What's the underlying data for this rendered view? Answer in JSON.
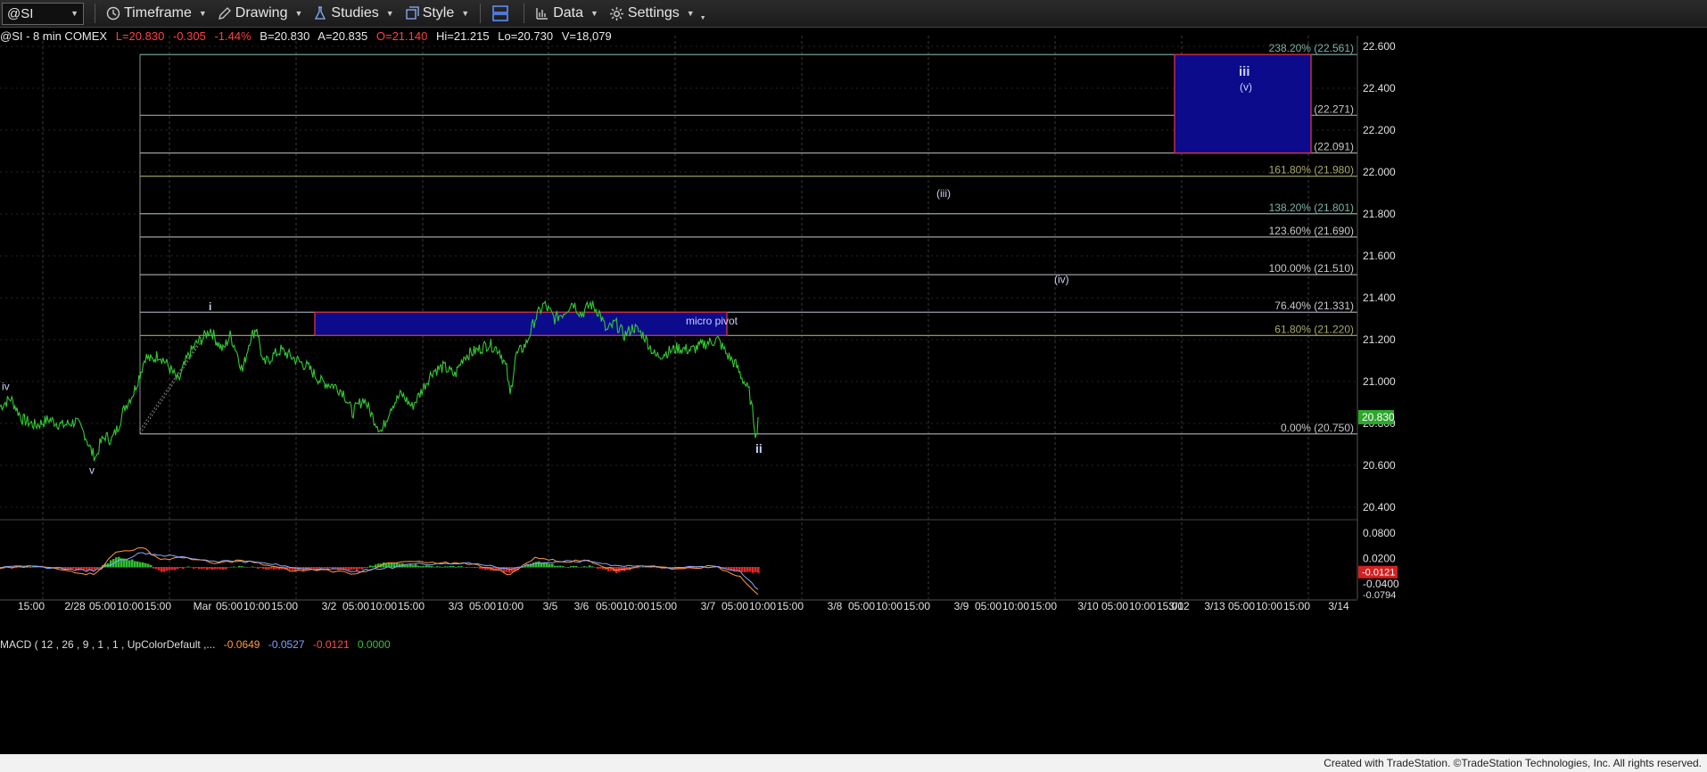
{
  "toolbar": {
    "symbol": "@SI",
    "items": [
      {
        "label": "Timeframe",
        "icon": "clock-icon"
      },
      {
        "label": "Drawing",
        "icon": "pencil-icon"
      },
      {
        "label": "Studies",
        "icon": "flask-icon"
      },
      {
        "label": "Style",
        "icon": "style-icon"
      },
      {
        "label": "Data",
        "icon": "bar-chart-icon"
      },
      {
        "label": "Settings",
        "icon": "gear-icon"
      }
    ]
  },
  "status": {
    "prefix": "@SI - 8 min  COMEX",
    "last": "L=20.830",
    "change": "-0.305",
    "pct": "-1.44%",
    "bid": "B=20.830",
    "ask": "A=20.835",
    "open": "O=21.140",
    "high": "Hi=21.215",
    "low": "Lo=20.730",
    "volume": "V=18,079"
  },
  "colors": {
    "price": "#32c832",
    "box_fill": "#0b0b8c",
    "box_border": "#c83246",
    "grid": "#2a2a2a",
    "fib_line": "#9aa0a8"
  },
  "chart_data": {
    "type": "line",
    "title": "",
    "price_axis": {
      "ylim": [
        20.33,
        22.64
      ],
      "ticks": [
        "22.600",
        "22.400",
        "22.200",
        "22.000",
        "21.800",
        "21.600",
        "21.400",
        "21.200",
        "21.000",
        "20.800",
        "20.600",
        "20.400"
      ],
      "tick_values": [
        22.6,
        22.4,
        22.2,
        22.0,
        21.8,
        21.6,
        21.4,
        21.2,
        21.0,
        20.8,
        20.6,
        20.4
      ],
      "last_price_label": "20.830",
      "last_price": 20.83
    },
    "time_axis": {
      "labels": [
        "15:00",
        "2/28",
        "05:00",
        "10:00",
        "15:00",
        "Mar",
        "05:00",
        "10:00",
        "15:00",
        "3/2",
        "05:00",
        "10:00",
        "15:00",
        "3/3",
        "05:00",
        "10:00",
        "3/5",
        "3/6",
        "05:00",
        "10:00",
        "15:00",
        "3/7",
        "05:00",
        "10:00",
        "15:00",
        "3/8",
        "05:00",
        "10:00",
        "15:00",
        "3/9",
        "05:00",
        "10:00",
        "15:00",
        "3/10",
        "05:00",
        "10:00",
        "15:00",
        "3/12",
        "3/13",
        "05:00",
        "10:00",
        "15:00",
        "3/14"
      ]
    },
    "fib_levels": [
      {
        "label": "238.20% (22.561)",
        "price": 22.561
      },
      {
        "label": "200.00% (22.271)",
        "price": 22.271
      },
      {
        "label": "176.40% (22.091)",
        "price": 22.091
      },
      {
        "label": "161.80% (21.980)",
        "price": 21.98
      },
      {
        "label": "138.20% (21.801)",
        "price": 21.801
      },
      {
        "label": "123.60% (21.690)",
        "price": 21.69
      },
      {
        "label": "100.00% (21.510)",
        "price": 21.51
      },
      {
        "label": "76.40% (21.331)",
        "price": 21.331
      },
      {
        "label": "61.80% (21.220)",
        "price": 21.22
      },
      {
        "label": "0.00% (20.750)",
        "price": 20.75
      }
    ],
    "boxes": [
      {
        "label": "micro pivot",
        "price_top": 21.331,
        "price_bottom": 21.22
      },
      {
        "label": "",
        "price_top": 22.561,
        "price_bottom": 22.091
      }
    ],
    "wave_labels": [
      {
        "label": "iv",
        "price": 20.96
      },
      {
        "label": "v",
        "price": 20.56
      },
      {
        "label": "i",
        "price": 21.34
      },
      {
        "label": "ii",
        "price": 20.66
      },
      {
        "label": "(iii)",
        "price": 21.88
      },
      {
        "label": "(iv)",
        "price": 21.47
      },
      {
        "label": "iii",
        "price": 22.46
      },
      {
        "label": "(v)",
        "price": 22.39
      }
    ],
    "price_series": [
      [
        0,
        20.88
      ],
      [
        12,
        20.92
      ],
      [
        25,
        20.82
      ],
      [
        40,
        20.79
      ],
      [
        55,
        20.82
      ],
      [
        70,
        20.79
      ],
      [
        85,
        20.81
      ],
      [
        95,
        20.75
      ],
      [
        103,
        20.66
      ],
      [
        108,
        20.64
      ],
      [
        112,
        20.7
      ],
      [
        118,
        20.74
      ],
      [
        125,
        20.72
      ],
      [
        132,
        20.78
      ],
      [
        140,
        20.88
      ],
      [
        150,
        20.95
      ],
      [
        158,
        21.05
      ],
      [
        163,
        21.12
      ],
      [
        170,
        21.1
      ],
      [
        178,
        21.13
      ],
      [
        186,
        21.09
      ],
      [
        194,
        21.04
      ],
      [
        200,
        21.0
      ],
      [
        206,
        21.07
      ],
      [
        212,
        21.13
      ],
      [
        220,
        21.18
      ],
      [
        228,
        21.21
      ],
      [
        236,
        21.25
      ],
      [
        242,
        21.2
      ],
      [
        250,
        21.15
      ],
      [
        258,
        21.22
      ],
      [
        265,
        21.15
      ],
      [
        272,
        21.05
      ],
      [
        280,
        21.2
      ],
      [
        288,
        21.26
      ],
      [
        295,
        21.08
      ],
      [
        305,
        21.12
      ],
      [
        315,
        21.15
      ],
      [
        330,
        21.11
      ],
      [
        345,
        21.07
      ],
      [
        360,
        21.0
      ],
      [
        375,
        20.98
      ],
      [
        385,
        20.95
      ],
      [
        395,
        20.85
      ],
      [
        408,
        20.92
      ],
      [
        418,
        20.83
      ],
      [
        428,
        20.76
      ],
      [
        438,
        20.88
      ],
      [
        450,
        20.94
      ],
      [
        462,
        20.88
      ],
      [
        472,
        20.95
      ],
      [
        485,
        21.05
      ],
      [
        498,
        21.07
      ],
      [
        510,
        21.03
      ],
      [
        520,
        21.12
      ],
      [
        535,
        21.15
      ],
      [
        548,
        21.18
      ],
      [
        560,
        21.15
      ],
      [
        568,
        21.06
      ],
      [
        572,
        20.93
      ],
      [
        578,
        21.12
      ],
      [
        590,
        21.18
      ],
      [
        600,
        21.3
      ],
      [
        610,
        21.37
      ],
      [
        622,
        21.3
      ],
      [
        632,
        21.33
      ],
      [
        642,
        21.38
      ],
      [
        652,
        21.32
      ],
      [
        662,
        21.37
      ],
      [
        672,
        21.33
      ],
      [
        680,
        21.24
      ],
      [
        690,
        21.28
      ],
      [
        700,
        21.22
      ],
      [
        710,
        21.26
      ],
      [
        722,
        21.22
      ],
      [
        735,
        21.12
      ],
      [
        748,
        21.14
      ],
      [
        760,
        21.16
      ],
      [
        775,
        21.15
      ],
      [
        790,
        21.18
      ],
      [
        805,
        21.2
      ],
      [
        815,
        21.13
      ],
      [
        825,
        21.08
      ],
      [
        833,
        21.01
      ],
      [
        840,
        20.95
      ],
      [
        845,
        20.82
      ],
      [
        848,
        20.73
      ],
      [
        850,
        20.83
      ]
    ],
    "macd": {
      "header": "MACD ( 12 , 26 , 9 , 1 , 1 , UpColorDefault ,...",
      "values": [
        "-0.0649",
        "-0.0527",
        "-0.0121",
        "0.0000"
      ],
      "axis_ticks": [
        "0.0800",
        "0.0200",
        "-0.0400"
      ],
      "axis_values": [
        0.08,
        0.02,
        -0.04
      ],
      "last_label": "-0.0121",
      "last_value": -0.0121,
      "min_label": "-0.0794",
      "ylim": [
        -0.08,
        0.1
      ],
      "macd_series": [
        [
          0,
          -0.004
        ],
        [
          40,
          0.002
        ],
        [
          80,
          -0.01
        ],
        [
          105,
          -0.018
        ],
        [
          130,
          0.035
        ],
        [
          160,
          0.045
        ],
        [
          180,
          0.018
        ],
        [
          210,
          0.022
        ],
        [
          240,
          0.008
        ],
        [
          270,
          0.016
        ],
        [
          300,
          0.004
        ],
        [
          330,
          -0.01
        ],
        [
          360,
          -0.006
        ],
        [
          400,
          -0.016
        ],
        [
          430,
          0.006
        ],
        [
          460,
          0.013
        ],
        [
          490,
          0.008
        ],
        [
          520,
          0.01
        ],
        [
          550,
          -0.002
        ],
        [
          572,
          -0.018
        ],
        [
          600,
          0.023
        ],
        [
          630,
          0.012
        ],
        [
          660,
          0.016
        ],
        [
          690,
          -0.008
        ],
        [
          720,
          0.003
        ],
        [
          760,
          -0.004
        ],
        [
          800,
          0.002
        ],
        [
          830,
          -0.022
        ],
        [
          850,
          -0.065
        ]
      ],
      "signal_series": [
        [
          0,
          -0.002
        ],
        [
          40,
          0.001
        ],
        [
          80,
          -0.005
        ],
        [
          105,
          -0.01
        ],
        [
          130,
          0.012
        ],
        [
          160,
          0.034
        ],
        [
          180,
          0.028
        ],
        [
          210,
          0.022
        ],
        [
          240,
          0.014
        ],
        [
          270,
          0.014
        ],
        [
          300,
          0.008
        ],
        [
          330,
          -0.002
        ],
        [
          360,
          -0.004
        ],
        [
          400,
          -0.01
        ],
        [
          430,
          -0.004
        ],
        [
          460,
          0.007
        ],
        [
          490,
          0.008
        ],
        [
          520,
          0.009
        ],
        [
          550,
          0.004
        ],
        [
          572,
          -0.006
        ],
        [
          600,
          0.009
        ],
        [
          630,
          0.012
        ],
        [
          660,
          0.014
        ],
        [
          690,
          0.004
        ],
        [
          720,
          0.002
        ],
        [
          760,
          -0.001
        ],
        [
          800,
          0.0
        ],
        [
          830,
          -0.01
        ],
        [
          850,
          -0.053
        ]
      ]
    }
  },
  "footer": {
    "text": "Created with TradeStation. ©TradeStation Technologies, Inc. All rights reserved."
  }
}
